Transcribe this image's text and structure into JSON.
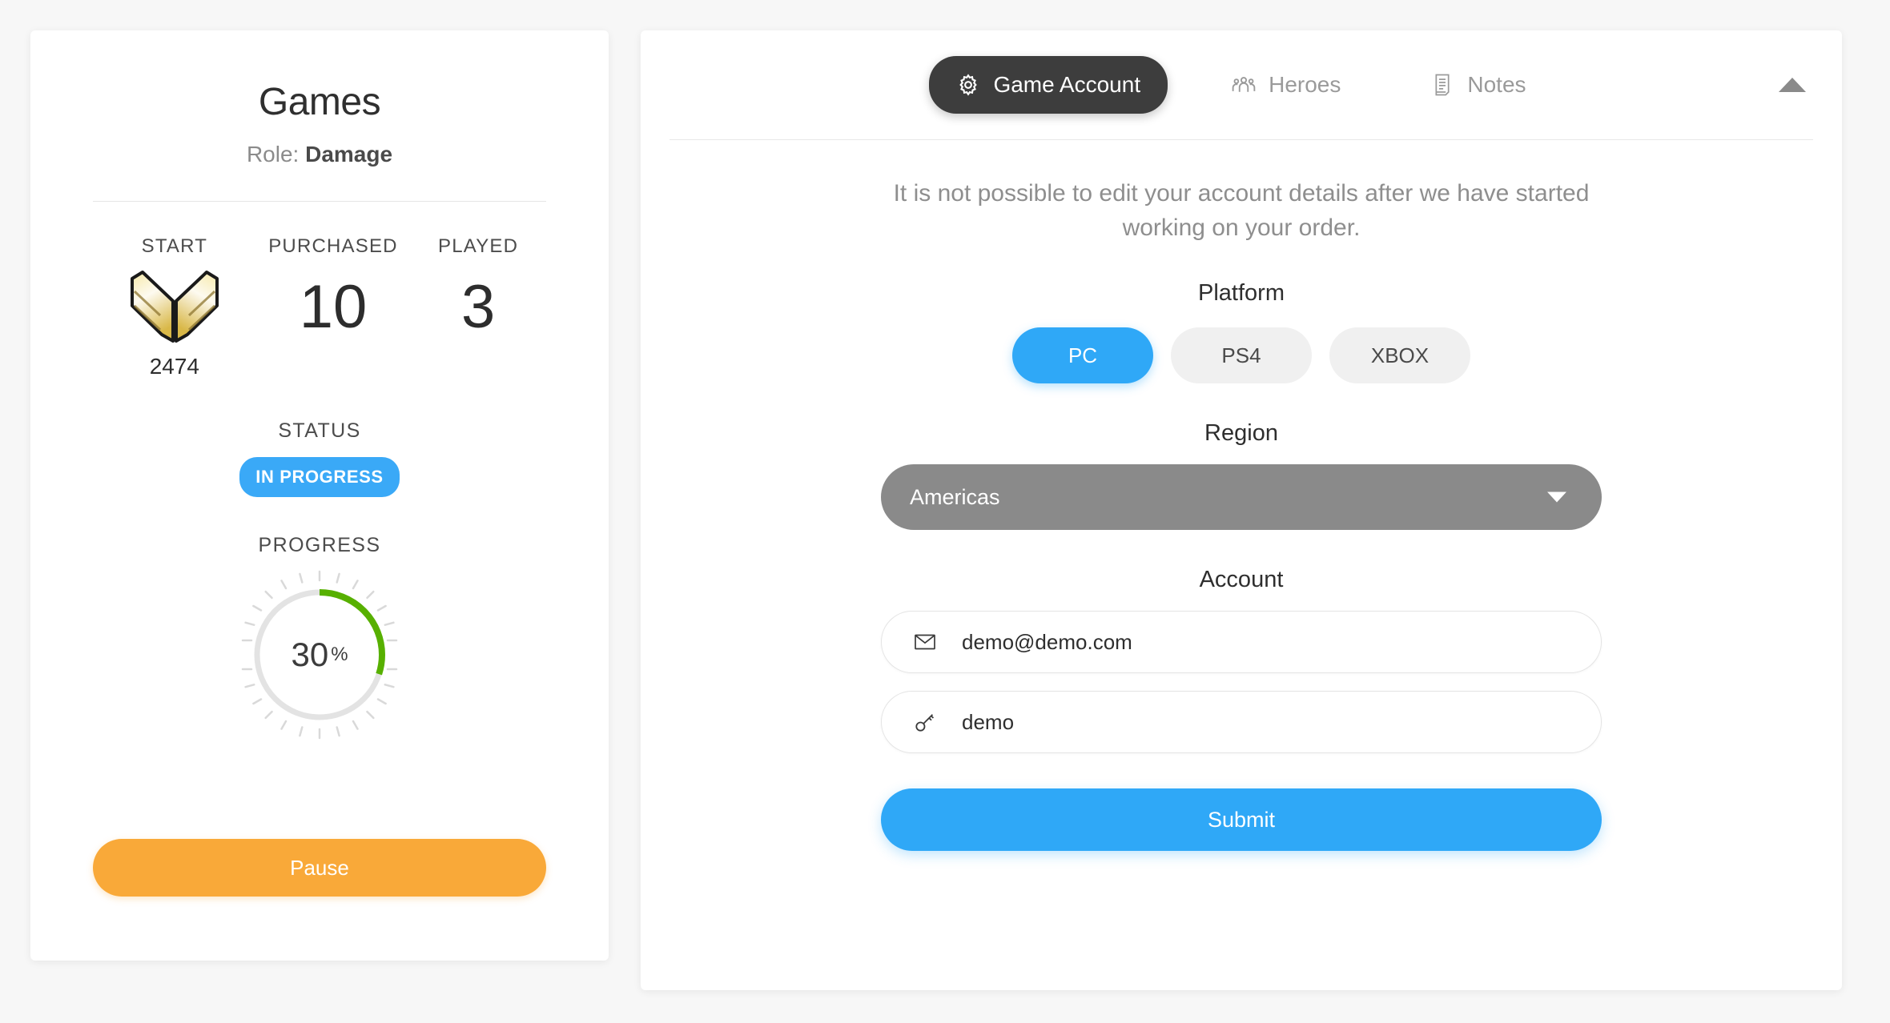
{
  "order_card": {
    "title": "Games",
    "role_prefix": "Role:",
    "role_value": "Damage",
    "stats": [
      {
        "label": "START",
        "kind": "rank",
        "rank_value": "2474"
      },
      {
        "label": "PURCHASED",
        "kind": "number",
        "value": "10"
      },
      {
        "label": "PLAYED",
        "kind": "number",
        "value": "3"
      }
    ],
    "status_label": "STATUS",
    "status_badge": "IN PROGRESS",
    "progress_label": "PROGRESS",
    "progress_percent": 30,
    "progress_percent_text": "30",
    "progress_symbol": "%",
    "pause_button": "Pause"
  },
  "detail_panel": {
    "tabs": [
      {
        "label": "Game Account",
        "icon": "gear-icon",
        "active": true
      },
      {
        "label": "Heroes",
        "icon": "group-icon",
        "active": false
      },
      {
        "label": "Notes",
        "icon": "notes-icon",
        "active": false
      }
    ],
    "collapse_icon": "caret-up-icon",
    "notice": "It is not possible to edit your account details after we have started working on your order.",
    "platform": {
      "label": "Platform",
      "options": [
        "PC",
        "PS4",
        "XBOX"
      ],
      "selected": "PC"
    },
    "region": {
      "label": "Region",
      "selected": "Americas",
      "caret_icon": "caret-down-icon"
    },
    "account": {
      "label": "Account",
      "fields": [
        {
          "icon": "envelope-icon",
          "value": "demo@demo.com",
          "placeholder": "Email"
        },
        {
          "icon": "key-icon",
          "value": "demo",
          "placeholder": "Password"
        }
      ]
    },
    "submit_button": "Submit"
  },
  "colors": {
    "accent_blue": "#2fa8f7",
    "status_blue": "#3aa9f7",
    "pause_orange": "#f9a939",
    "progress_green": "#57b000",
    "tab_active_dark": "#3d3d3d",
    "region_gray": "#8a8a8a",
    "rank_gold": "#e8cf7a"
  }
}
